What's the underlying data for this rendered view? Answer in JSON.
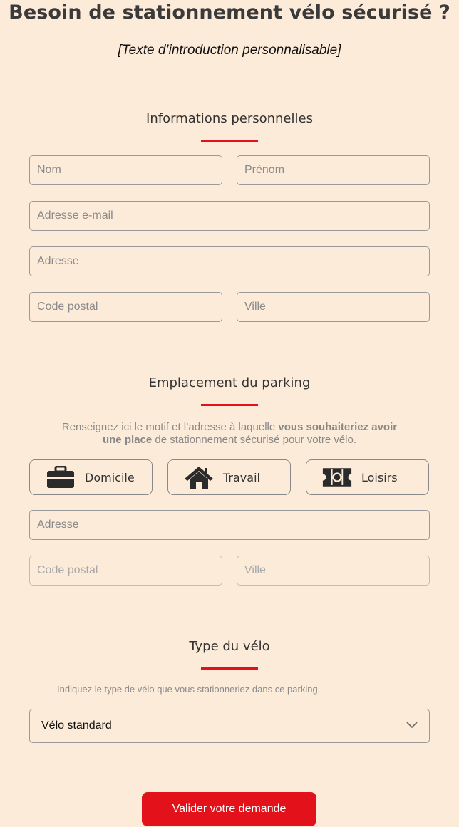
{
  "header": {
    "title": "Besoin de stationnement vélo sécurisé ?",
    "intro": "[Texte d’introduction personnalisable]"
  },
  "personal": {
    "title": "Informations personnelles",
    "fields": {
      "nom": "Nom",
      "prenom": "Prénom",
      "email": "Adresse e-mail",
      "adresse": "Adresse",
      "code_postal": "Code postal",
      "ville": "Ville"
    }
  },
  "parking": {
    "title": "Emplacement du parking",
    "desc_part1": "Renseignez ici le motif et l’adresse à laquelle ",
    "desc_bold": "vous souhaiteriez avoir une place",
    "desc_part2": " de stationnement sécurisé pour votre vélo.",
    "choices": [
      {
        "label": "Domicile",
        "icon": "briefcase-icon"
      },
      {
        "label": "Travail",
        "icon": "house-icon"
      },
      {
        "label": "Loisirs",
        "icon": "ticket-icon"
      }
    ],
    "fields": {
      "adresse": "Adresse",
      "code_postal": "Code postal",
      "ville": "Ville"
    }
  },
  "bike": {
    "title": "Type du vélo",
    "desc": "Indiquez le type de vélo que vous stationneriez dans ce parking.",
    "selected": "Vélo standard"
  },
  "submit_label": "Valider votre demande",
  "colors": {
    "background": "#fdebd9",
    "accent": "#e3121a"
  }
}
